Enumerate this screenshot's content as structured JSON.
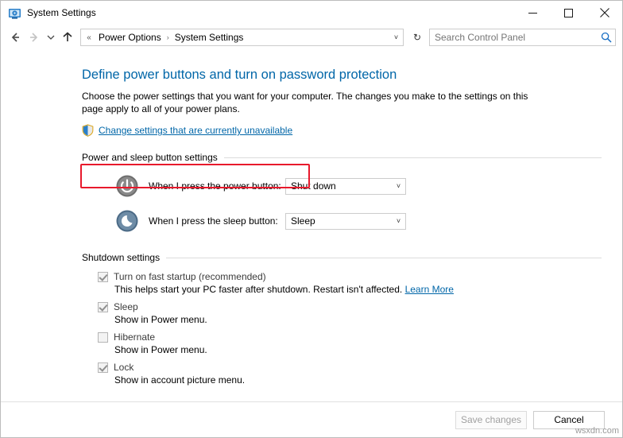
{
  "window": {
    "title": "System Settings",
    "icon": "system-settings-icon",
    "minimize": "─",
    "maximize": "☐",
    "close": "✕"
  },
  "nav": {
    "back": "←",
    "forward": "→",
    "recent": "˅",
    "up": "↑"
  },
  "address": {
    "leading_chevrons": "«",
    "segments": [
      "Power Options",
      "System Settings"
    ],
    "separator": "›",
    "dropdown": "˅",
    "refresh": "↻"
  },
  "search": {
    "placeholder": "Search Control Panel",
    "value": "",
    "icon": "search-icon"
  },
  "main": {
    "heading": "Define power buttons and turn on password protection",
    "description": "Choose the power settings that you want for your computer. The changes you make to the settings on this page apply to all of your power plans.",
    "admin_link": "Change settings that are currently unavailable",
    "admin_link_icon": "shield-icon",
    "highlight_color": "#e8192c",
    "link_color": "#0066a8",
    "sections": [
      {
        "label": "Power and sleep button settings",
        "rows": [
          {
            "icon": "power-button-icon",
            "label": "When I press the power button:",
            "value": "Shut down",
            "arrow": "˅"
          },
          {
            "icon": "sleep-button-icon",
            "label": "When I press the sleep button:",
            "value": "Sleep",
            "arrow": "˅"
          }
        ]
      },
      {
        "label": "Shutdown settings",
        "items": [
          {
            "checked": true,
            "label": "Turn on fast startup (recommended)",
            "sub": "This helps start your PC faster after shutdown. Restart isn't affected.",
            "sub_link": "Learn More"
          },
          {
            "checked": true,
            "label": "Sleep",
            "sub": "Show in Power menu.",
            "sub_link": ""
          },
          {
            "checked": false,
            "label": "Hibernate",
            "sub": "Show in Power menu.",
            "sub_link": ""
          },
          {
            "checked": true,
            "label": "Lock",
            "sub": "Show in account picture menu.",
            "sub_link": ""
          }
        ]
      }
    ]
  },
  "footer": {
    "save": "Save changes",
    "cancel": "Cancel"
  },
  "watermark": "wsxdn.com"
}
